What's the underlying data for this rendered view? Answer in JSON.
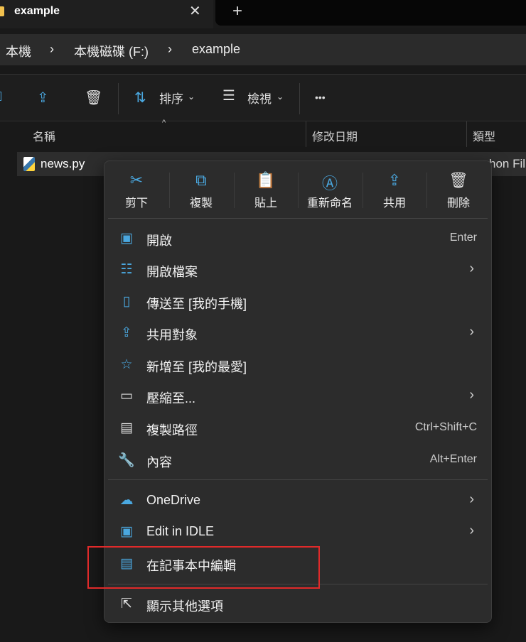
{
  "tab": {
    "title": "example",
    "close": "✕",
    "new_tab": "+"
  },
  "breadcrumb": [
    "本機",
    "本機磁碟 (F:)",
    "example"
  ],
  "breadcrumb_sep": "›",
  "toolbar": {
    "sort": "排序",
    "view": "檢視",
    "more": "•••",
    "chevron": "⌄"
  },
  "columns": {
    "name": "名稱",
    "modified": "修改日期",
    "type": "類型"
  },
  "file": {
    "name": "news.py",
    "type": "hon Fil"
  },
  "quick_actions": [
    {
      "label": "剪下",
      "icon": "✂"
    },
    {
      "label": "複製",
      "icon": "⧉"
    },
    {
      "label": "貼上",
      "icon": "📋"
    },
    {
      "label": "重新命名",
      "icon": "Ⓐ"
    },
    {
      "label": "共用",
      "icon": "⇪"
    },
    {
      "label": "刪除",
      "icon": "🗑"
    }
  ],
  "items": [
    {
      "label": "開啟",
      "shortcut": "Enter",
      "icon": "▣",
      "sub": false
    },
    {
      "label": "開啟檔案",
      "shortcut": "",
      "icon": "☷",
      "sub": true
    },
    {
      "label": "傳送至 [我的手機]",
      "shortcut": "",
      "icon": "▯",
      "sub": false
    },
    {
      "label": "共用對象",
      "shortcut": "",
      "icon": "⇪",
      "sub": true
    },
    {
      "label": "新增至 [我的最愛]",
      "shortcut": "",
      "icon": "☆",
      "sub": false
    },
    {
      "label": "壓縮至...",
      "shortcut": "",
      "icon": "▭",
      "sub": true
    },
    {
      "label": "複製路徑",
      "shortcut": "Ctrl+Shift+C",
      "icon": "▤",
      "sub": false
    },
    {
      "label": "內容",
      "shortcut": "Alt+Enter",
      "icon": "🔧",
      "sub": false
    },
    {
      "label": "OneDrive",
      "shortcut": "",
      "icon": "☁",
      "sub": true
    },
    {
      "label": "Edit in IDLE",
      "shortcut": "",
      "icon": "▣",
      "sub": true
    },
    {
      "label": "在記事本中編輯",
      "shortcut": "",
      "icon": "▤",
      "sub": false
    },
    {
      "label": "顯示其他選項",
      "shortcut": "",
      "icon": "⇱",
      "sub": false
    }
  ],
  "submenu_chevron": "›",
  "colors": {
    "accent": "#4aa8e0",
    "highlight": "#e02a2a"
  }
}
